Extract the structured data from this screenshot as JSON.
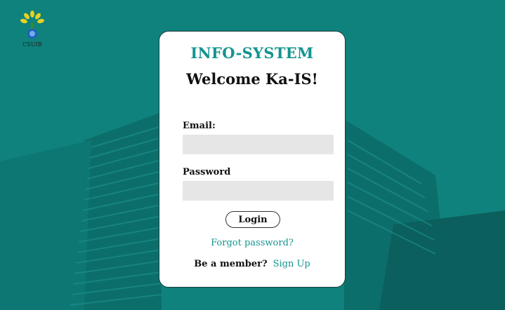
{
  "logo": {
    "text": "CSUIB"
  },
  "login_card": {
    "app_title": "INFO-SYSTEM",
    "welcome": "Welcome Ka-IS!",
    "email_label": "Email:",
    "email_value": "",
    "password_label": "Password",
    "password_value": "",
    "login_button": "Login",
    "forgot_password": "Forgot password?",
    "member_prompt": "Be a member?",
    "sign_up": "Sign Up"
  },
  "colors": {
    "background": "#0f827d",
    "accent": "#14948f",
    "card": "#ffffff",
    "input_bg": "#e6e6e6"
  }
}
